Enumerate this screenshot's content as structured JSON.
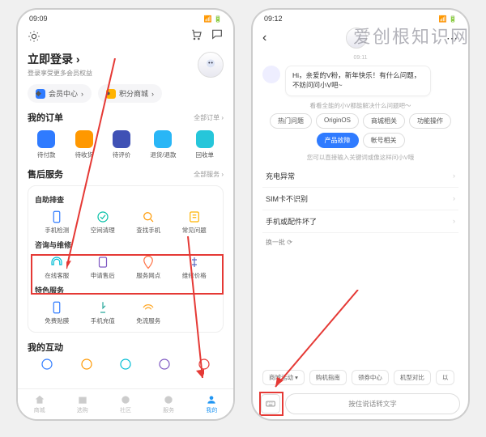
{
  "watermark": "爱创根知识网",
  "phone1": {
    "time": "09:09",
    "login_title": "立即登录",
    "login_arrow": "›",
    "login_sub": "登录享受更多会员权益",
    "pills": {
      "member": "会员中心",
      "points": "积分商城"
    },
    "orders": {
      "title": "我的订单",
      "all": "全部订单 ›",
      "items": [
        {
          "label": "待付款",
          "color": "#2f7bff"
        },
        {
          "label": "待收货",
          "color": "#ff9800"
        },
        {
          "label": "待评价",
          "color": "#3f51b5"
        },
        {
          "label": "退货/退款",
          "color": "#29b6f6"
        },
        {
          "label": "回收单",
          "color": "#26c6da"
        }
      ]
    },
    "aftersale": {
      "title": "售后服务",
      "link": "全部服务 ›",
      "self_check": "自助排查",
      "self_items": [
        {
          "label": "手机检测",
          "color": "#2f7bff"
        },
        {
          "label": "空间清理",
          "color": "#00bfa5"
        },
        {
          "label": "查找手机",
          "color": "#ff9800"
        },
        {
          "label": "常见问题",
          "color": "#ffb300"
        }
      ],
      "consult": "咨询与维修",
      "consult_items": [
        {
          "label": "在线客服",
          "color": "#00bcd4"
        },
        {
          "label": "申请售后",
          "color": "#7e57c2"
        },
        {
          "label": "服务网点",
          "color": "#ff7043"
        },
        {
          "label": "维修价格",
          "color": "#5c6bc0"
        }
      ],
      "special": "特色服务",
      "special_items": [
        {
          "label": "免费贴膜",
          "color": "#2f7bff"
        },
        {
          "label": "手机充值",
          "color": "#26a69a"
        },
        {
          "label": "免流服务",
          "color": "#ffa726"
        }
      ]
    },
    "interact_title": "我的互动",
    "nav": [
      {
        "label": "商城"
      },
      {
        "label": "选购"
      },
      {
        "label": "社区"
      },
      {
        "label": "服务"
      },
      {
        "label": "我的"
      }
    ]
  },
  "phone2": {
    "time": "09:12",
    "chat_time": "09:11",
    "greeting": "Hi，亲爱的V粉，新年快乐！有什么问题，不妨问问小V吧~",
    "hint1": "看看全能的小V都能解决什么问题吧～",
    "categories": [
      {
        "label": "热门问题"
      },
      {
        "label": "OriginOS"
      },
      {
        "label": "商城相关"
      },
      {
        "label": "功能操作"
      },
      {
        "label": "产品故障",
        "active": true
      },
      {
        "label": "帐号相关"
      }
    ],
    "hint2": "您可以直接输入关键词或像这样问小V哦",
    "questions": [
      "充电异常",
      "SIM卡不识别",
      "手机或配件坏了"
    ],
    "refresh": "换一批",
    "refresh_icon": "⟳",
    "bottom_chips": [
      "商城活动",
      "购机指南",
      "领券中心",
      "机型对比",
      "以"
    ],
    "voice_input": "按住说话转文字"
  },
  "colors": {
    "highlight": "#e53935",
    "primary": "#2f7bff"
  }
}
